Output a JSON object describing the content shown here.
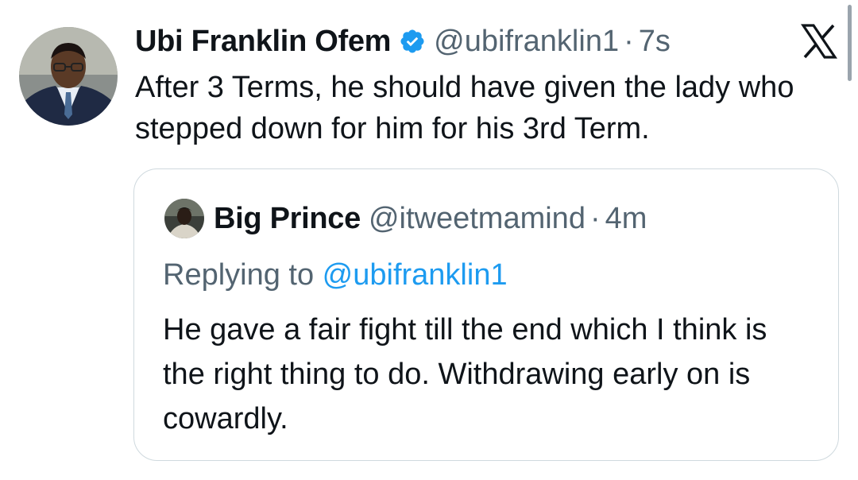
{
  "tweet": {
    "author_name": "Ubi Franklin Ofem",
    "handle": "@ubifranklin1",
    "separator": "·",
    "time": "7s",
    "text": "After 3 Terms, he should have given the lady who stepped down for him for his 3rd Term."
  },
  "quoted": {
    "author_name": "Big Prince",
    "handle": "@itweetmamind",
    "separator": "·",
    "time": "4m",
    "reply_prefix": "Replying to ",
    "reply_mention": "@ubifranklin1",
    "text": "He gave a fair fight till the end which I think is the right thing to do. Withdrawing early on is cowardly."
  },
  "icons": {
    "verified": "verified-badge-icon",
    "brand": "x-logo-icon"
  },
  "colors": {
    "text": "#0f1419",
    "secondary": "#536471",
    "accent": "#1d9bf0",
    "border": "#cfd9de"
  }
}
